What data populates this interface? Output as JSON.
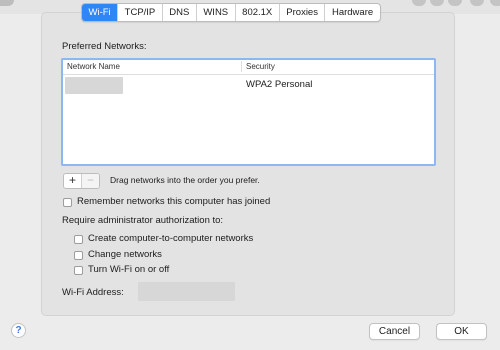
{
  "tabs": [
    "Wi-Fi",
    "TCP/IP",
    "DNS",
    "WINS",
    "802.1X",
    "Proxies",
    "Hardware"
  ],
  "active_tab": "Wi-Fi",
  "preferred_networks": {
    "label": "Preferred Networks:",
    "columns": {
      "name": "Network Name",
      "security": "Security"
    },
    "rows": [
      {
        "name": "",
        "security": "WPA2 Personal"
      }
    ]
  },
  "add_button": "+",
  "remove_button": "−",
  "drag_hint": "Drag networks into the order you prefer.",
  "remember_label": "Remember networks this computer has joined",
  "require_admin_label": "Require administrator authorization to:",
  "admin_options": [
    "Create computer-to-computer networks",
    "Change networks",
    "Turn Wi-Fi on or off"
  ],
  "wifi_address_label": "Wi-Fi Address:",
  "help_button": "?",
  "cancel_button": "Cancel",
  "ok_button": "OK",
  "colors": {
    "accent": "#2f86f6",
    "table_border": "#8eb6ef"
  }
}
